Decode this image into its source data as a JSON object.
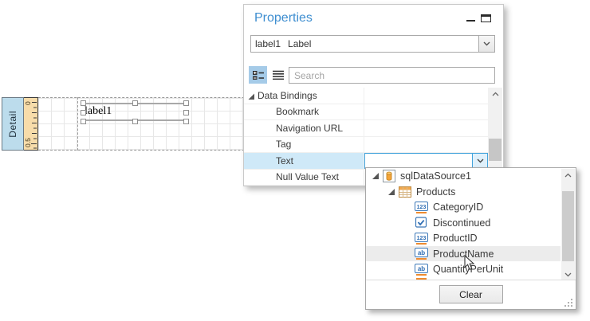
{
  "design_surface": {
    "band": {
      "label": "Detail"
    },
    "ruler": {
      "tick_labels": [
        "0",
        "0.5"
      ]
    },
    "label_control": {
      "text": "label1"
    }
  },
  "properties_panel": {
    "title": "Properties",
    "selector": {
      "name": "label1",
      "type": "Label"
    },
    "search_placeholder": "Search",
    "category_row": {
      "label": "Data Bindings"
    },
    "rows": [
      {
        "label": "Bookmark"
      },
      {
        "label": "Navigation URL"
      },
      {
        "label": "Tag"
      },
      {
        "label": "Text"
      },
      {
        "label": "Null Value Text"
      }
    ]
  },
  "field_list_popup": {
    "nodes": [
      {
        "label": "sqlDataSource1",
        "icon": "database-icon",
        "level": 0,
        "expanded": true
      },
      {
        "label": "Products",
        "icon": "table-icon",
        "level": 1,
        "expanded": true
      },
      {
        "label": "CategoryID",
        "icon": "number-field-icon",
        "level": 2
      },
      {
        "label": "Discontinued",
        "icon": "boolean-field-icon",
        "level": 2
      },
      {
        "label": "ProductID",
        "icon": "number-field-icon",
        "level": 2
      },
      {
        "label": "ProductName",
        "icon": "text-field-icon",
        "level": 2,
        "hovered": true
      },
      {
        "label": "QuantityPerUnit",
        "icon": "text-field-icon",
        "level": 2
      }
    ],
    "clear_button_label": "Clear"
  },
  "colors": {
    "accent_blue": "#3e8ed0",
    "selection_blue": "#cfe9f8",
    "toolbar_selected": "#a5cbe8",
    "band_fill": "#bcdcec",
    "ruler_fill": "#f7dcaa",
    "field_icon_orange": "#ef8b2f",
    "field_icon_blue": "#3c78b8"
  }
}
